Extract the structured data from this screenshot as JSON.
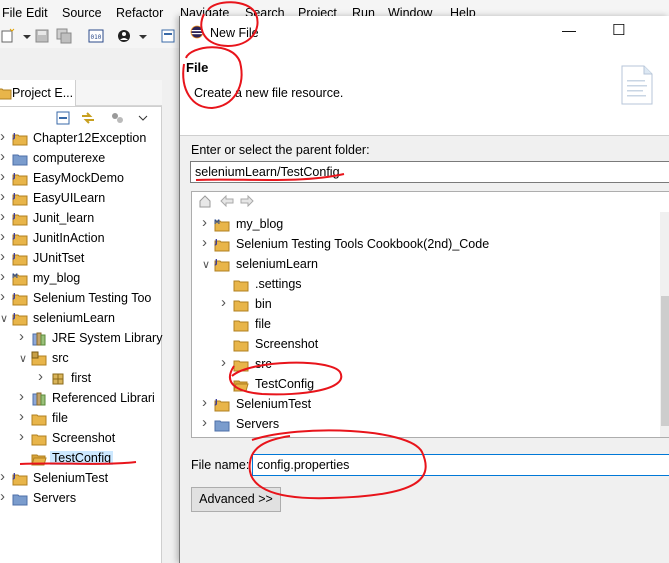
{
  "menubar": {
    "items": [
      "File",
      "Edit",
      "Source",
      "Refactor",
      "Navigate",
      "Search",
      "Project",
      "Run",
      "Window",
      "Help"
    ]
  },
  "explorer": {
    "tab_label": "Project E...",
    "items": [
      {
        "label": "Chapter12Exception",
        "icon": "java-project-icon",
        "twisty": ">"
      },
      {
        "label": "computerexe",
        "icon": "project-icon",
        "twisty": ">"
      },
      {
        "label": "EasyMockDemo",
        "icon": "java-project-icon",
        "twisty": ">"
      },
      {
        "label": "EasyUILearn",
        "icon": "java-project-icon",
        "twisty": ">"
      },
      {
        "label": "Junit_learn",
        "icon": "java-project-icon",
        "twisty": ">"
      },
      {
        "label": "JunitInAction",
        "icon": "java-project-icon",
        "twisty": ">"
      },
      {
        "label": "JUnitTset",
        "icon": "java-project-icon",
        "twisty": ">"
      },
      {
        "label": "my_blog",
        "icon": "maven-project-icon",
        "twisty": ">"
      },
      {
        "label": "Selenium Testing Too",
        "icon": "java-project-icon",
        "twisty": ">"
      },
      {
        "label": "seleniumLearn",
        "icon": "java-project-icon",
        "twisty": "v"
      },
      {
        "label": "JRE System Library",
        "icon": "library-icon",
        "twisty": ">"
      },
      {
        "label": "src",
        "icon": "source-folder-icon",
        "twisty": "v"
      },
      {
        "label": "first",
        "icon": "package-icon",
        "twisty": ">"
      },
      {
        "label": "Referenced Librari",
        "icon": "library-icon",
        "twisty": ">"
      },
      {
        "label": "file",
        "icon": "folder-icon",
        "twisty": ">"
      },
      {
        "label": "Screenshot",
        "icon": "folder-icon",
        "twisty": ">"
      },
      {
        "label": "TestConfig",
        "icon": "folder-open-icon",
        "twisty": ""
      },
      {
        "label": "SeleniumTest",
        "icon": "java-project-icon",
        "twisty": ">"
      },
      {
        "label": "Servers",
        "icon": "project-icon",
        "twisty": ">"
      }
    ]
  },
  "dialog": {
    "title": "New File",
    "header_title": "File",
    "header_desc": "Create a new file resource.",
    "parent_label": "Enter or select the parent folder:",
    "parent_value": "seleniumLearn/TestConfig",
    "tree": [
      {
        "label": "my_blog",
        "icon": "maven-project-icon",
        "twisty": ">"
      },
      {
        "label": "Selenium Testing Tools Cookbook(2nd)_Code",
        "icon": "java-project-icon",
        "twisty": ">"
      },
      {
        "label": "seleniumLearn",
        "icon": "java-project-icon",
        "twisty": "v"
      },
      {
        "label": ".settings",
        "icon": "folder-icon",
        "twisty": ""
      },
      {
        "label": "bin",
        "icon": "folder-icon",
        "twisty": ">"
      },
      {
        "label": "file",
        "icon": "folder-icon",
        "twisty": ""
      },
      {
        "label": "Screenshot",
        "icon": "folder-icon",
        "twisty": ""
      },
      {
        "label": "src",
        "icon": "folder-icon",
        "twisty": ">"
      },
      {
        "label": "TestConfig",
        "icon": "folder-open-icon",
        "twisty": ""
      },
      {
        "label": "SeleniumTest",
        "icon": "java-project-icon",
        "twisty": ">"
      },
      {
        "label": "Servers",
        "icon": "project-icon",
        "twisty": ">"
      }
    ],
    "filename_label": "File name:",
    "filename_value": "config.properties",
    "advanced_label": "Advanced >>",
    "minimize_glyph": "—",
    "maximize_glyph": "☐"
  },
  "colors": {
    "annotation": "#e8141b",
    "folder": "#e8b54a",
    "project": "#7a9ccd",
    "selection": "#cce8ff"
  }
}
